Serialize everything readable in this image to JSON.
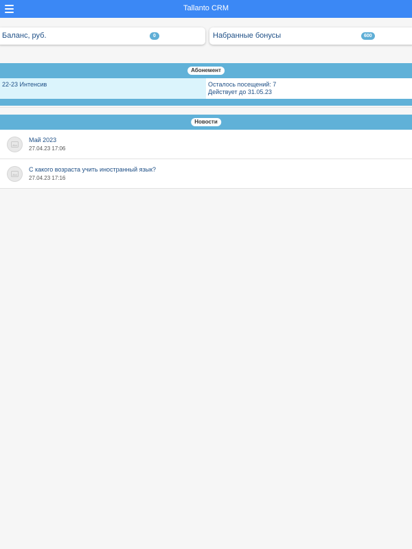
{
  "header": {
    "title": "Tallanto CRM",
    "menu_icon": "hamburger-menu-icon",
    "color": "#3b88f5"
  },
  "balance": {
    "label": "Баланс, руб.",
    "value": "0"
  },
  "bonuses": {
    "label": "Набранные бонусы",
    "value": "600"
  },
  "subscription": {
    "section_title": "Абонемент",
    "name": "22-23 Интенсив",
    "remaining": "Осталось посещений: 7",
    "valid_until": "Действует до 31.05.23"
  },
  "news": {
    "section_title": "Новости",
    "items": [
      {
        "title": "Май 2023",
        "date": "27.04.23 17:06",
        "icon": "news-thumbnail-icon"
      },
      {
        "title": "С какого возраста учить иностранный язык?",
        "date": "27.04.23 17:16",
        "icon": "news-thumbnail-icon"
      }
    ]
  },
  "colors": {
    "accent": "#3b88f5",
    "section_bar": "#60b1d8",
    "link_text": "#1e4f86",
    "highlight_cell": "#dbf4fc"
  }
}
